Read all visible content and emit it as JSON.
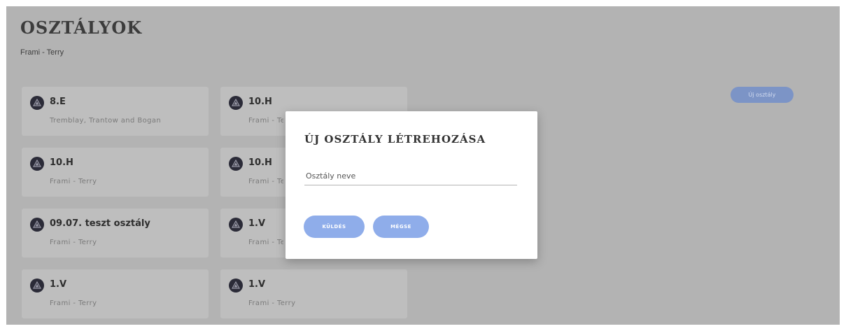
{
  "page": {
    "title": "OSZTÁLYOK",
    "subtitle": "Frami - Terry",
    "new_class_button": "Új osztály"
  },
  "cards": [
    {
      "title": "8.E",
      "subtitle": "Tremblay, Trantow and Bogan"
    },
    {
      "title": "10.H",
      "subtitle": "Frami - Terry"
    },
    {
      "title": "10.H",
      "subtitle": "Frami - Terry"
    },
    {
      "title": "10.H",
      "subtitle": "Frami - Terry"
    },
    {
      "title": "09.07. teszt osztály",
      "subtitle": "Frami - Terry"
    },
    {
      "title": "1.V",
      "subtitle": "Frami - Terry"
    },
    {
      "title": "1.V",
      "subtitle": "Frami - Terry"
    },
    {
      "title": "1.V",
      "subtitle": "Frami - Terry"
    }
  ],
  "modal": {
    "title": "ÚJ OSZTÁLY LÉTREHOZÁSA",
    "input_placeholder": "Osztály neve",
    "input_value": "",
    "send_label": "KÜLDÉS",
    "cancel_label": "MÉGSE"
  },
  "icons": {
    "card_avatar": "avatar-icon"
  },
  "colors": {
    "overlay_background": "#b3b3b3",
    "primary_button": "#8fadea",
    "avatar": "#2b2b38"
  }
}
